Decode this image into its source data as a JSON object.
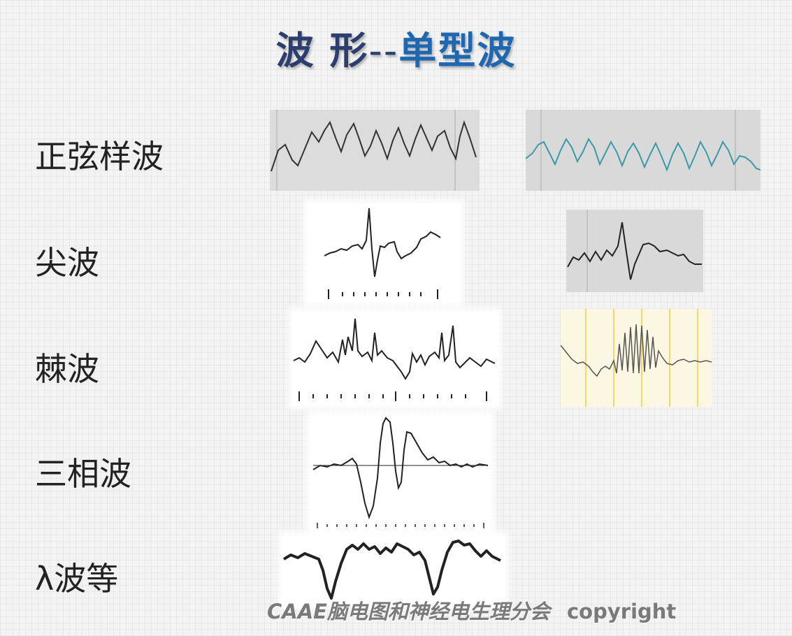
{
  "title": {
    "part1": "波 形",
    "separator": "--",
    "part2": "单型波"
  },
  "rows": [
    {
      "label": "正弦样波"
    },
    {
      "label": "尖波"
    },
    {
      "label": "棘波"
    },
    {
      "label": "三相波"
    },
    {
      "label": "λ波等"
    }
  ],
  "footer": {
    "org": "CAAE脑电图和神经电生理分会",
    "copyright": "copyright"
  },
  "colors": {
    "title_dark": "#2c3e6d",
    "title_blue": "#1f67b1",
    "teal_wave": "#3a9aa8"
  }
}
